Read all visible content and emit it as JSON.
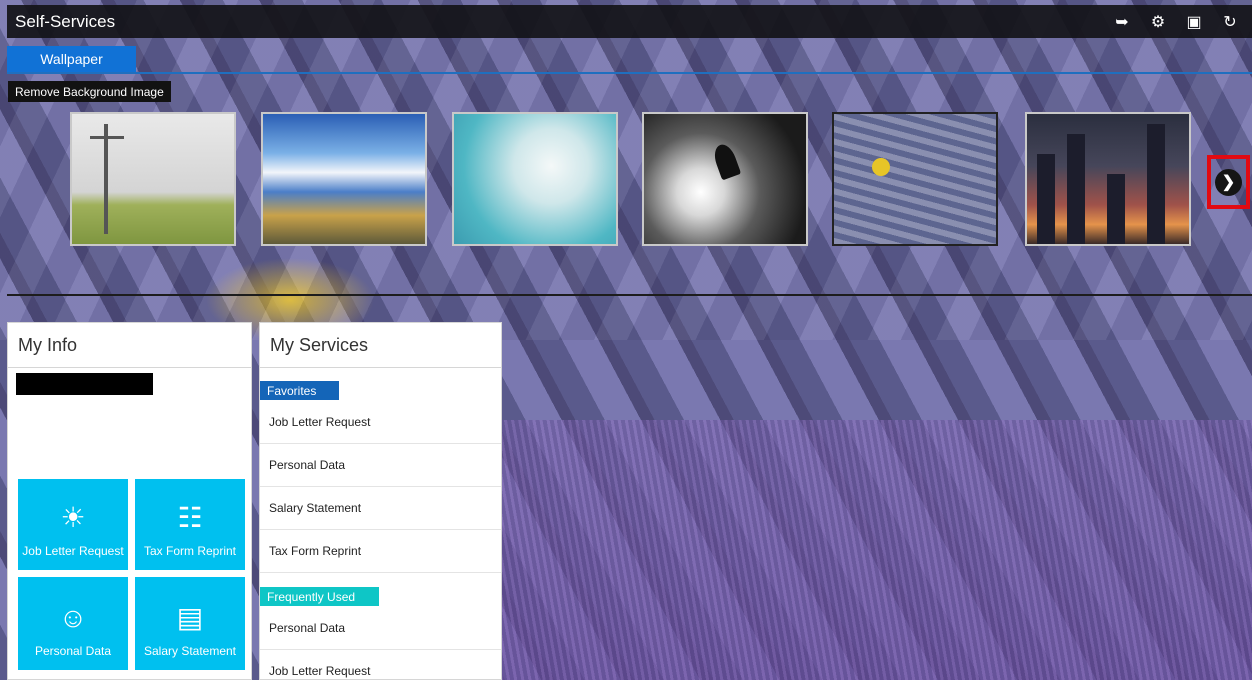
{
  "header": {
    "title": "Self-Services",
    "actions": [
      {
        "name": "back",
        "glyph": "➥"
      },
      {
        "name": "settings",
        "glyph": "⚙"
      },
      {
        "name": "image",
        "glyph": "▣"
      },
      {
        "name": "refresh",
        "glyph": "↻"
      }
    ]
  },
  "tabs": [
    {
      "label": "Wallpaper"
    }
  ],
  "wallpaper": {
    "remove_label": "Remove Background Image",
    "next_glyph": "❯",
    "thumbnails": [
      {
        "name": "signpost"
      },
      {
        "name": "road-sky"
      },
      {
        "name": "dandelion"
      },
      {
        "name": "snowboarder"
      },
      {
        "name": "lavander-field"
      },
      {
        "name": "city-night"
      }
    ]
  },
  "my_info": {
    "title": "My Info",
    "tiles": [
      {
        "label": "Job Letter Request",
        "icon": "☀"
      },
      {
        "label": "Tax Form Reprint",
        "icon": "☷"
      },
      {
        "label": "Personal Data",
        "icon": "☺"
      },
      {
        "label": "Salary Statement",
        "icon": "▤"
      }
    ]
  },
  "my_services": {
    "title": "My Services",
    "favorites_label": "Favorites",
    "favorites": [
      "Job Letter Request",
      "Personal Data",
      "Salary Statement",
      "Tax Form Reprint"
    ],
    "frequent_label": "Frequently Used",
    "frequent": [
      "Personal Data",
      "Job Letter Request"
    ]
  },
  "colors": {
    "tile": "#00c0ef",
    "tab": "#1172d6",
    "favorites": "#1465b8",
    "frequent": "#0ec6c6",
    "highlight": "#e10a12"
  }
}
